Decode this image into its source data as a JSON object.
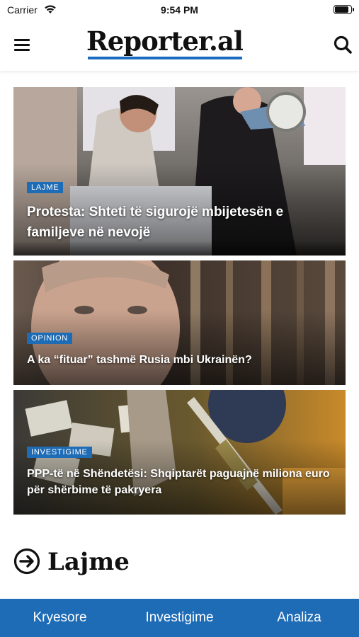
{
  "status_bar": {
    "carrier": "Carrier",
    "time": "9:54 PM",
    "battery_level": 0.9
  },
  "header": {
    "logo_text": "Reporter.al",
    "menu_icon": "hamburger-menu-icon",
    "search_icon": "search-icon",
    "accent_color": "#1a6bc1"
  },
  "articles": [
    {
      "category": "LAJME",
      "title": "Protesta: Shteti të sigurojë mbijetesën e familjeve në nevojë",
      "image": "protest-photo"
    },
    {
      "category": "OPINION",
      "title": "A ka “fituar” tashmë Rusia mbi Ukrainën?",
      "image": "portrait-photo"
    },
    {
      "category": "INVESTIGIME",
      "title": "PPP-të në Shëndetësi: Shqiptarët paguajnë miliona euro për shërbime të pakryera",
      "image": "collage-illustration"
    }
  ],
  "section": {
    "title": "Lajme",
    "icon": "arrow-circle-right-icon"
  },
  "bottom_nav": {
    "background": "#1f6cb6",
    "items": [
      {
        "label": "Kryesore"
      },
      {
        "label": "Investigime"
      },
      {
        "label": "Analiza"
      }
    ]
  }
}
